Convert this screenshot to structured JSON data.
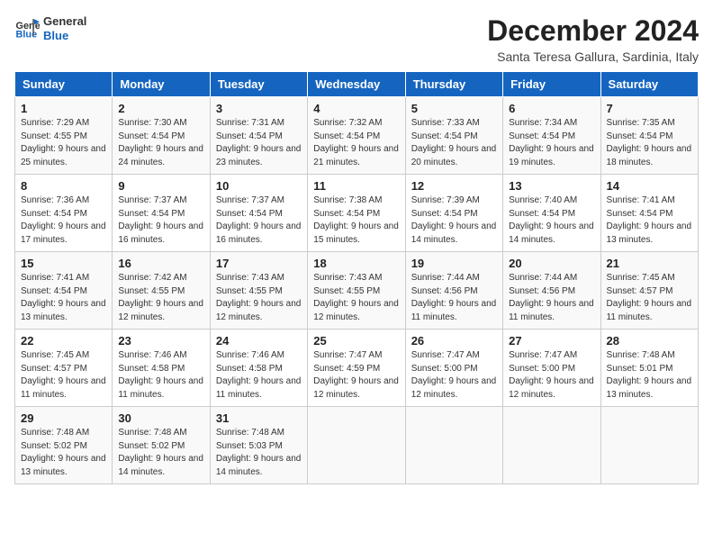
{
  "logo": {
    "line1": "General",
    "line2": "Blue"
  },
  "title": "December 2024",
  "location": "Santa Teresa Gallura, Sardinia, Italy",
  "days_of_week": [
    "Sunday",
    "Monday",
    "Tuesday",
    "Wednesday",
    "Thursday",
    "Friday",
    "Saturday"
  ],
  "weeks": [
    [
      {
        "num": "1",
        "sunrise": "Sunrise: 7:29 AM",
        "sunset": "Sunset: 4:55 PM",
        "daylight": "Daylight: 9 hours and 25 minutes."
      },
      {
        "num": "2",
        "sunrise": "Sunrise: 7:30 AM",
        "sunset": "Sunset: 4:54 PM",
        "daylight": "Daylight: 9 hours and 24 minutes."
      },
      {
        "num": "3",
        "sunrise": "Sunrise: 7:31 AM",
        "sunset": "Sunset: 4:54 PM",
        "daylight": "Daylight: 9 hours and 23 minutes."
      },
      {
        "num": "4",
        "sunrise": "Sunrise: 7:32 AM",
        "sunset": "Sunset: 4:54 PM",
        "daylight": "Daylight: 9 hours and 21 minutes."
      },
      {
        "num": "5",
        "sunrise": "Sunrise: 7:33 AM",
        "sunset": "Sunset: 4:54 PM",
        "daylight": "Daylight: 9 hours and 20 minutes."
      },
      {
        "num": "6",
        "sunrise": "Sunrise: 7:34 AM",
        "sunset": "Sunset: 4:54 PM",
        "daylight": "Daylight: 9 hours and 19 minutes."
      },
      {
        "num": "7",
        "sunrise": "Sunrise: 7:35 AM",
        "sunset": "Sunset: 4:54 PM",
        "daylight": "Daylight: 9 hours and 18 minutes."
      }
    ],
    [
      {
        "num": "8",
        "sunrise": "Sunrise: 7:36 AM",
        "sunset": "Sunset: 4:54 PM",
        "daylight": "Daylight: 9 hours and 17 minutes."
      },
      {
        "num": "9",
        "sunrise": "Sunrise: 7:37 AM",
        "sunset": "Sunset: 4:54 PM",
        "daylight": "Daylight: 9 hours and 16 minutes."
      },
      {
        "num": "10",
        "sunrise": "Sunrise: 7:37 AM",
        "sunset": "Sunset: 4:54 PM",
        "daylight": "Daylight: 9 hours and 16 minutes."
      },
      {
        "num": "11",
        "sunrise": "Sunrise: 7:38 AM",
        "sunset": "Sunset: 4:54 PM",
        "daylight": "Daylight: 9 hours and 15 minutes."
      },
      {
        "num": "12",
        "sunrise": "Sunrise: 7:39 AM",
        "sunset": "Sunset: 4:54 PM",
        "daylight": "Daylight: 9 hours and 14 minutes."
      },
      {
        "num": "13",
        "sunrise": "Sunrise: 7:40 AM",
        "sunset": "Sunset: 4:54 PM",
        "daylight": "Daylight: 9 hours and 14 minutes."
      },
      {
        "num": "14",
        "sunrise": "Sunrise: 7:41 AM",
        "sunset": "Sunset: 4:54 PM",
        "daylight": "Daylight: 9 hours and 13 minutes."
      }
    ],
    [
      {
        "num": "15",
        "sunrise": "Sunrise: 7:41 AM",
        "sunset": "Sunset: 4:54 PM",
        "daylight": "Daylight: 9 hours and 13 minutes."
      },
      {
        "num": "16",
        "sunrise": "Sunrise: 7:42 AM",
        "sunset": "Sunset: 4:55 PM",
        "daylight": "Daylight: 9 hours and 12 minutes."
      },
      {
        "num": "17",
        "sunrise": "Sunrise: 7:43 AM",
        "sunset": "Sunset: 4:55 PM",
        "daylight": "Daylight: 9 hours and 12 minutes."
      },
      {
        "num": "18",
        "sunrise": "Sunrise: 7:43 AM",
        "sunset": "Sunset: 4:55 PM",
        "daylight": "Daylight: 9 hours and 12 minutes."
      },
      {
        "num": "19",
        "sunrise": "Sunrise: 7:44 AM",
        "sunset": "Sunset: 4:56 PM",
        "daylight": "Daylight: 9 hours and 11 minutes."
      },
      {
        "num": "20",
        "sunrise": "Sunrise: 7:44 AM",
        "sunset": "Sunset: 4:56 PM",
        "daylight": "Daylight: 9 hours and 11 minutes."
      },
      {
        "num": "21",
        "sunrise": "Sunrise: 7:45 AM",
        "sunset": "Sunset: 4:57 PM",
        "daylight": "Daylight: 9 hours and 11 minutes."
      }
    ],
    [
      {
        "num": "22",
        "sunrise": "Sunrise: 7:45 AM",
        "sunset": "Sunset: 4:57 PM",
        "daylight": "Daylight: 9 hours and 11 minutes."
      },
      {
        "num": "23",
        "sunrise": "Sunrise: 7:46 AM",
        "sunset": "Sunset: 4:58 PM",
        "daylight": "Daylight: 9 hours and 11 minutes."
      },
      {
        "num": "24",
        "sunrise": "Sunrise: 7:46 AM",
        "sunset": "Sunset: 4:58 PM",
        "daylight": "Daylight: 9 hours and 11 minutes."
      },
      {
        "num": "25",
        "sunrise": "Sunrise: 7:47 AM",
        "sunset": "Sunset: 4:59 PM",
        "daylight": "Daylight: 9 hours and 12 minutes."
      },
      {
        "num": "26",
        "sunrise": "Sunrise: 7:47 AM",
        "sunset": "Sunset: 5:00 PM",
        "daylight": "Daylight: 9 hours and 12 minutes."
      },
      {
        "num": "27",
        "sunrise": "Sunrise: 7:47 AM",
        "sunset": "Sunset: 5:00 PM",
        "daylight": "Daylight: 9 hours and 12 minutes."
      },
      {
        "num": "28",
        "sunrise": "Sunrise: 7:48 AM",
        "sunset": "Sunset: 5:01 PM",
        "daylight": "Daylight: 9 hours and 13 minutes."
      }
    ],
    [
      {
        "num": "29",
        "sunrise": "Sunrise: 7:48 AM",
        "sunset": "Sunset: 5:02 PM",
        "daylight": "Daylight: 9 hours and 13 minutes."
      },
      {
        "num": "30",
        "sunrise": "Sunrise: 7:48 AM",
        "sunset": "Sunset: 5:02 PM",
        "daylight": "Daylight: 9 hours and 14 minutes."
      },
      {
        "num": "31",
        "sunrise": "Sunrise: 7:48 AM",
        "sunset": "Sunset: 5:03 PM",
        "daylight": "Daylight: 9 hours and 14 minutes."
      },
      null,
      null,
      null,
      null
    ]
  ]
}
